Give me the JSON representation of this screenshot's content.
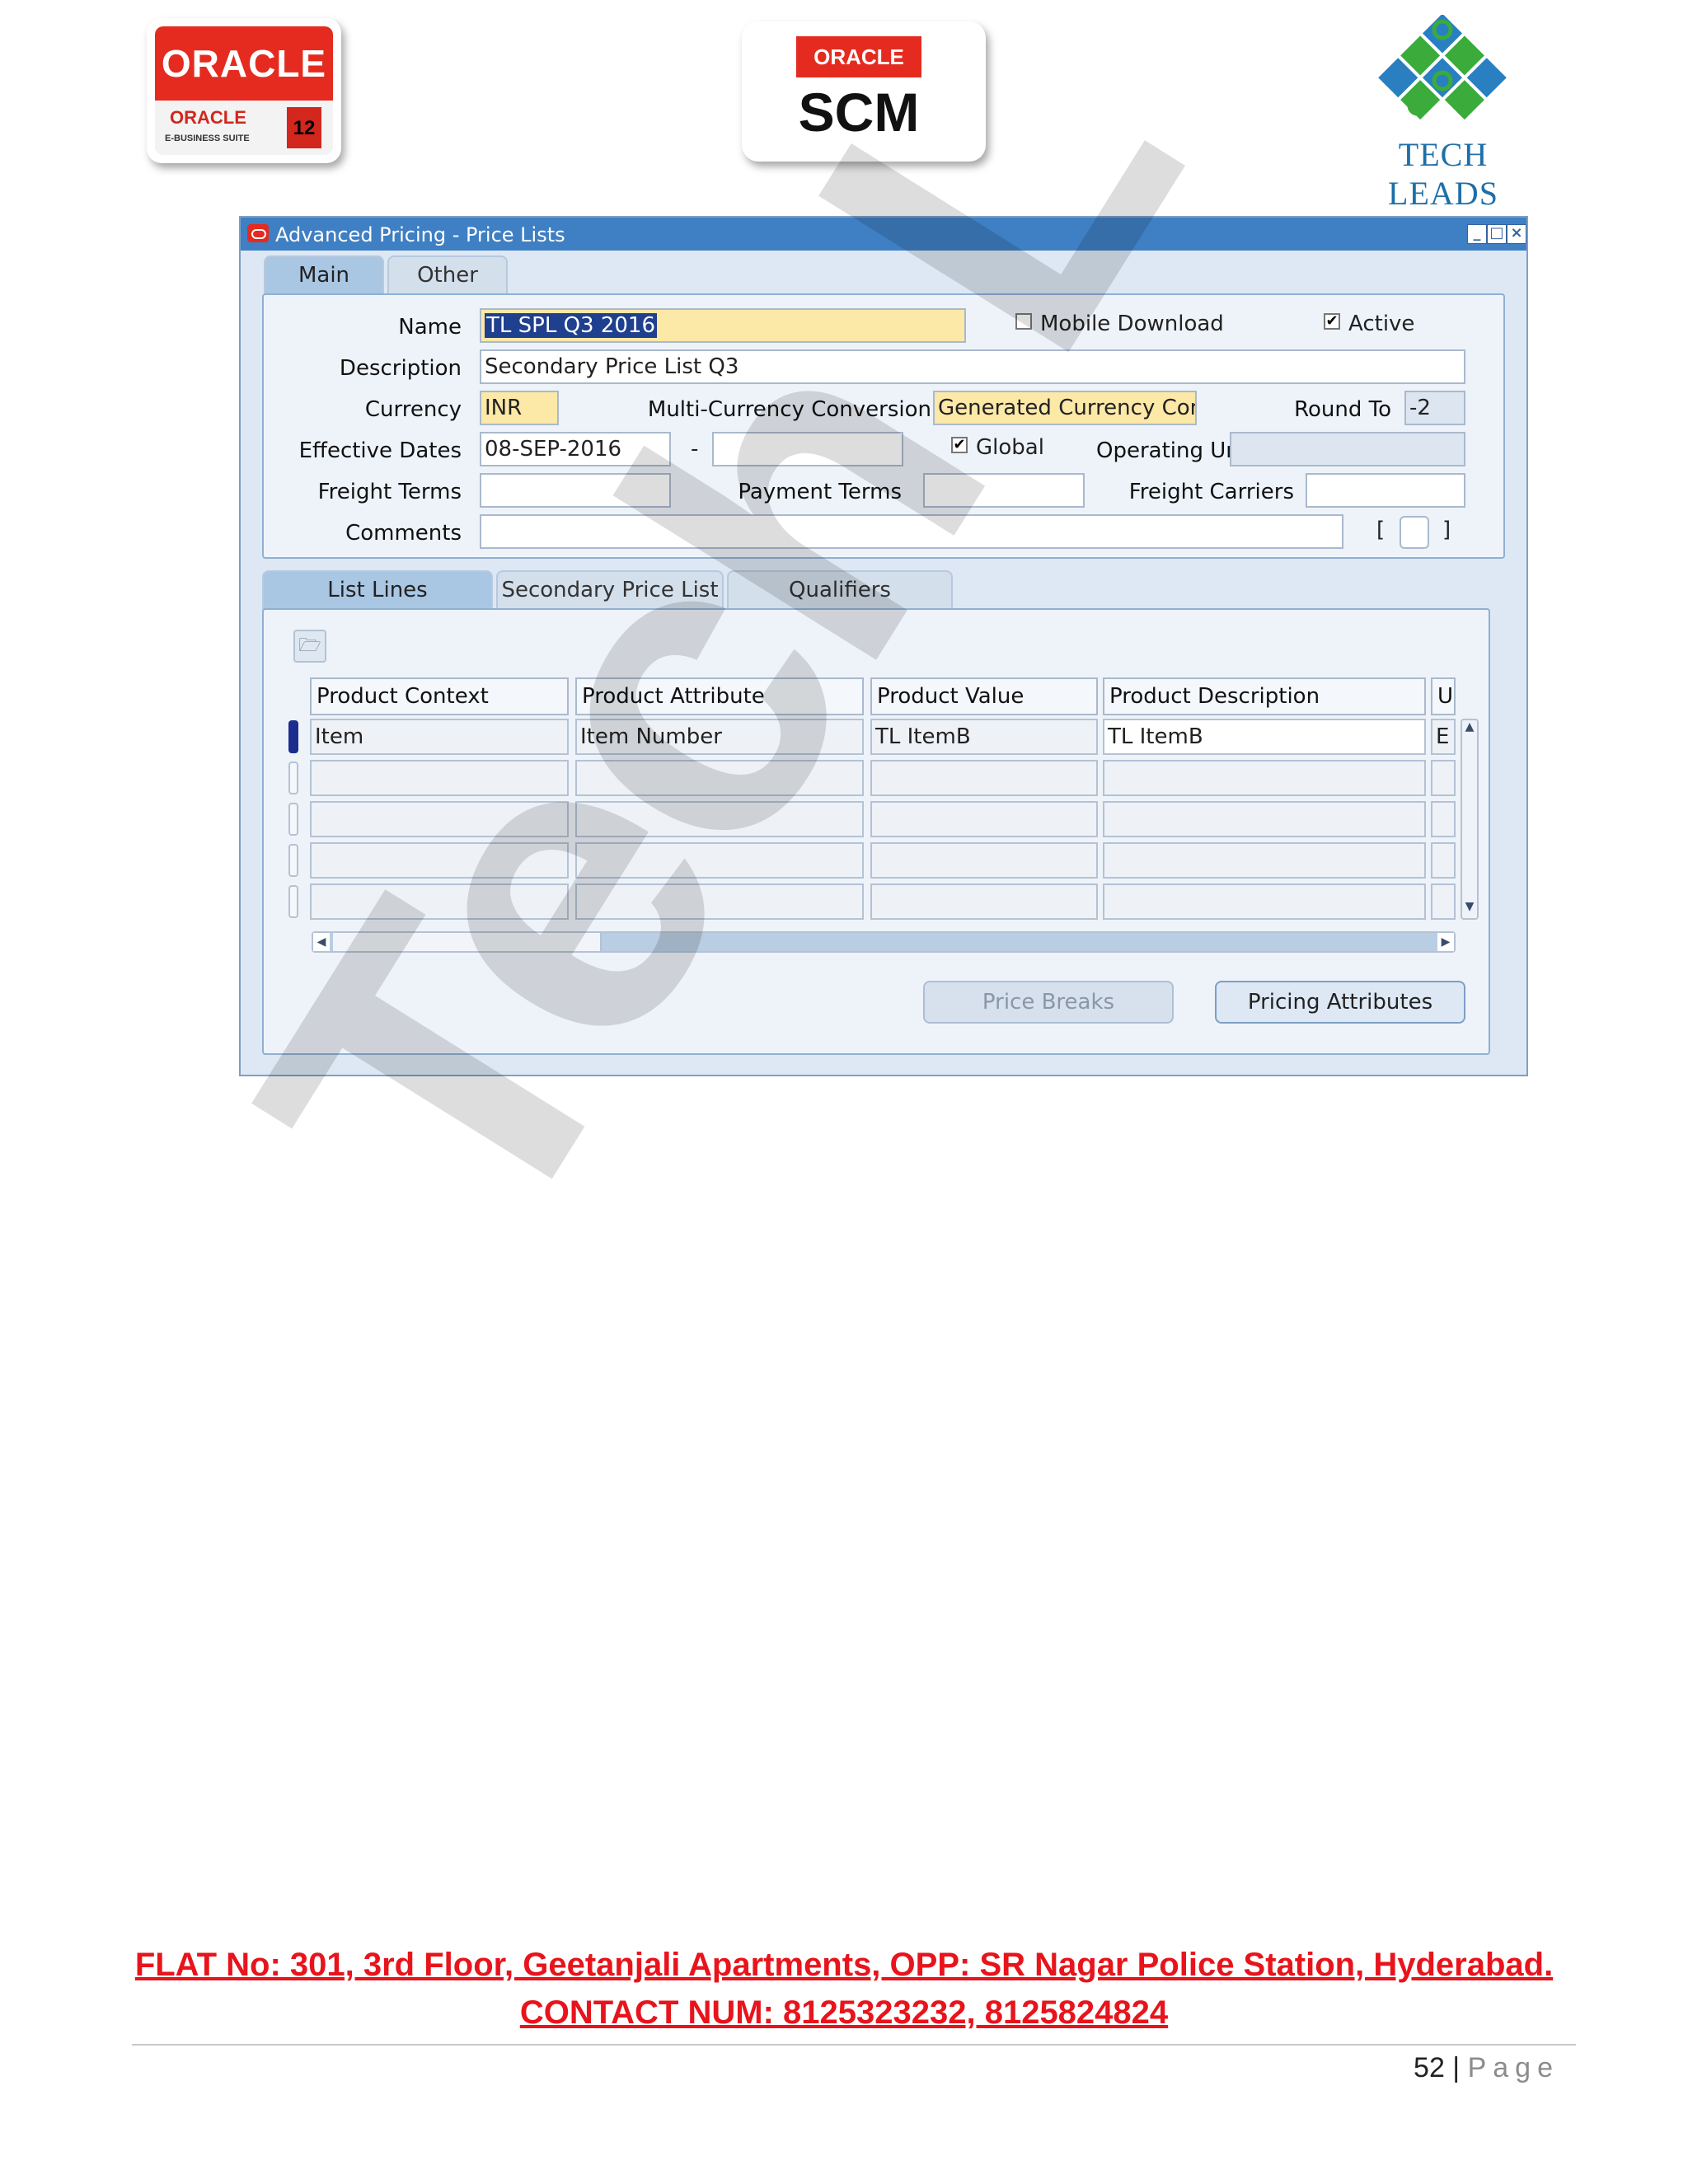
{
  "header": {
    "oracle_logo": {
      "top": "ORACLE",
      "sub": "ORACLE",
      "suite": "E-BUSINESS SUITE",
      "release": "12"
    },
    "scm_logo": {
      "brand": "ORACLE",
      "product": "SCM"
    },
    "techleads_logo": {
      "name": "TECH LEADS"
    }
  },
  "window": {
    "title": "Advanced Pricing - Price Lists",
    "tabs": [
      "Main",
      "Other"
    ],
    "form": {
      "name_label": "Name",
      "name_value": "TL SPL Q3 2016",
      "mobile_download_label": "Mobile Download",
      "mobile_download_checked": false,
      "active_label": "Active",
      "active_checked": true,
      "description_label": "Description",
      "description_value": "Secondary Price List Q3",
      "currency_label": "Currency",
      "currency_value": "INR",
      "multi_currency_label": "Multi-Currency Conversion",
      "multi_currency_value": "Generated Currency Conve",
      "round_to_label": "Round To",
      "round_to_value": "-2",
      "effective_dates_label": "Effective Dates",
      "effective_from": "08-SEP-2016",
      "effective_to": "",
      "dash": "-",
      "global_label": "Global",
      "global_checked": true,
      "operating_unit_label": "Operating Unit",
      "operating_unit_value": "",
      "freight_terms_label": "Freight Terms",
      "freight_terms_value": "",
      "payment_terms_label": "Payment Terms",
      "payment_terms_value": "",
      "freight_carriers_label": "Freight Carriers",
      "freight_carriers_value": "",
      "comments_label": "Comments",
      "comments_value": "",
      "bracket_open": "[",
      "bracket_close": "]"
    },
    "sub_tabs": [
      "List Lines",
      "Secondary Price List",
      "Qualifiers"
    ],
    "grid": {
      "columns": [
        "Product Context",
        "Product Attribute",
        "Product Value",
        "Product Description",
        "U"
      ],
      "rows": [
        [
          "Item",
          "Item Number",
          "TL ItemB",
          "TL ItemB",
          "E"
        ],
        [
          "",
          "",
          "",
          "",
          ""
        ],
        [
          "",
          "",
          "",
          "",
          ""
        ],
        [
          "",
          "",
          "",
          "",
          ""
        ],
        [
          "",
          "",
          "",
          "",
          ""
        ]
      ]
    },
    "buttons": {
      "price_breaks": "Price Breaks",
      "pricing_attributes": "Pricing Attributes"
    }
  },
  "watermark": "Tech L",
  "footer": {
    "address": "FLAT No: 301, 3rd Floor, Geetanjali Apartments, OPP: SR Nagar Police Station, Hyderabad.",
    "contact": "CONTACT NUM: 8125323232, 8125824824",
    "page_number": "52",
    "page_word": "Page"
  }
}
